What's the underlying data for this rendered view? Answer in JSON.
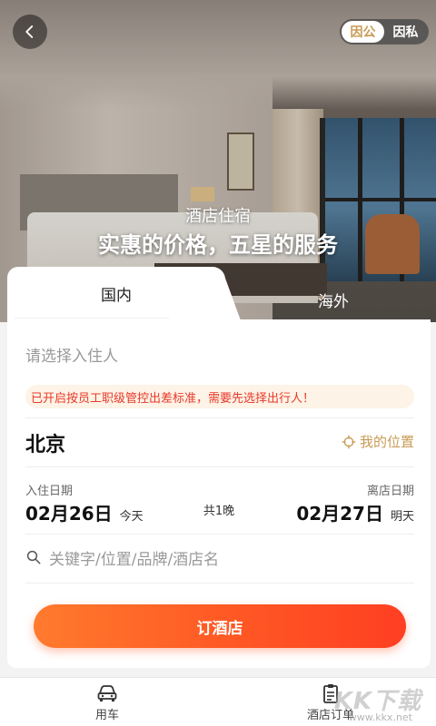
{
  "header": {
    "back_icon": "chevron-left-icon",
    "toggle": {
      "business": "因公",
      "private": "因私",
      "selected": "business"
    }
  },
  "hero": {
    "subtitle": "酒店住宿",
    "title": "实惠的价格，五星的服务"
  },
  "tabs": [
    {
      "label": "国内",
      "active": true
    },
    {
      "label": "海外",
      "active": false
    }
  ],
  "form": {
    "guest_placeholder": "请选择入住人",
    "notice": "已开启按员工职级管控出差标准，需要先选择出行人！",
    "city": "北京",
    "my_location": "我的位置",
    "checkin": {
      "label": "入住日期",
      "date": "02月26日",
      "day": "今天"
    },
    "checkout": {
      "label": "离店日期",
      "date": "02月27日",
      "day": "明天"
    },
    "nights": "共1晚",
    "search_placeholder": "关键字/位置/品牌/酒店名",
    "book_button": "订酒店"
  },
  "bottom_nav": [
    {
      "label": "用车",
      "icon": "car-icon"
    },
    {
      "label": "酒店订单",
      "icon": "clipboard-icon"
    }
  ],
  "watermark": {
    "big": "KK下载",
    "small": "www.kkx.net"
  },
  "colors": {
    "accent_gold": "#c89b55",
    "notice_red": "#e8392a",
    "button_start": "#ff7a2e",
    "button_end": "#ff3f22"
  }
}
